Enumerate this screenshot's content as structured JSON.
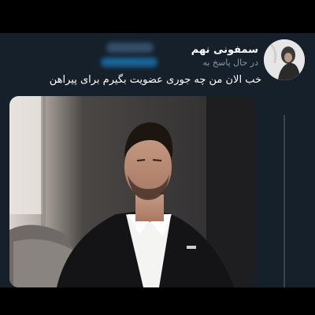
{
  "tweet": {
    "display_name": "سمفونی نهم",
    "reply_prefix": "در حال پاسخ به",
    "text": "خب الان من چه جوری عضویت بگیرم برای پیراهن"
  },
  "colors": {
    "background": "#15202b",
    "text_primary": "#ffffff",
    "text_secondary": "#8899a6",
    "accent": "#1d9bf0",
    "thread_line": "#38444d"
  },
  "icons": {
    "avatar": "profile-avatar",
    "media": "tweet-photo"
  }
}
